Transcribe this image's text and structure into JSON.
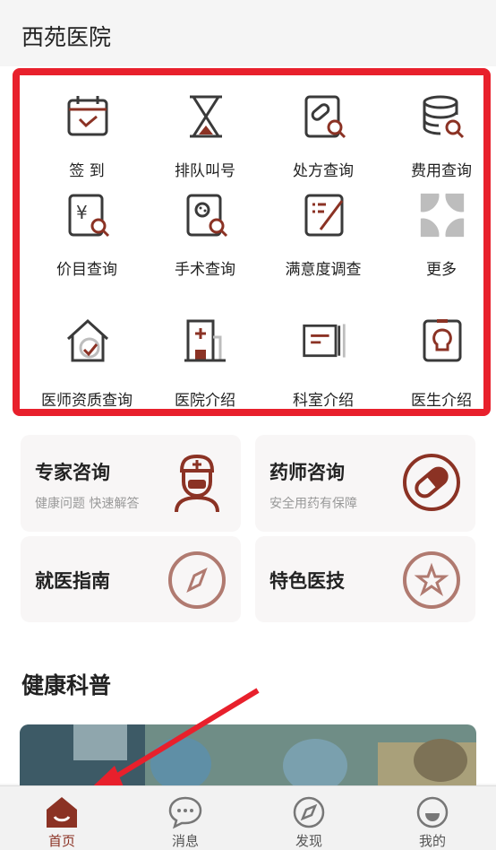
{
  "header": {
    "title": "西苑医院"
  },
  "grid": {
    "items": [
      {
        "label": "签 到",
        "icon": "checkin-calendar-icon"
      },
      {
        "label": "排队叫号",
        "icon": "hourglass-icon"
      },
      {
        "label": "处方查询",
        "icon": "prescription-search-icon"
      },
      {
        "label": "费用查询",
        "icon": "cost-search-icon"
      },
      {
        "label": "价目查询",
        "icon": "price-search-icon"
      },
      {
        "label": "手术查询",
        "icon": "surgery-search-icon"
      },
      {
        "label": "满意度调查",
        "icon": "survey-icon"
      },
      {
        "label": "更多",
        "icon": "more-icon"
      },
      {
        "label": "医师资质查询",
        "icon": "doctor-qualification-icon"
      },
      {
        "label": "医院介绍",
        "icon": "hospital-icon"
      },
      {
        "label": "科室介绍",
        "icon": "department-icon"
      },
      {
        "label": "医生介绍",
        "icon": "doctor-badge-icon"
      }
    ]
  },
  "cards": [
    {
      "title": "专家咨询",
      "subtitle": "健康问题 快速解答",
      "icon": "doctor-avatar-icon"
    },
    {
      "title": "药师咨询",
      "subtitle": "安全用药有保障",
      "icon": "pill-icon"
    },
    {
      "title": "就医指南",
      "subtitle": "",
      "icon": "compass-icon"
    },
    {
      "title": "特色医技",
      "subtitle": "",
      "icon": "star-icon"
    }
  ],
  "section": {
    "title": "健康科普"
  },
  "tabbar": {
    "tabs": [
      {
        "label": "首页",
        "icon": "home-icon",
        "active": true
      },
      {
        "label": "消息",
        "icon": "message-icon",
        "active": false
      },
      {
        "label": "发现",
        "icon": "discover-icon",
        "active": false
      },
      {
        "label": "我的",
        "icon": "profile-icon",
        "active": false
      }
    ]
  },
  "colors": {
    "accent": "#8b3224",
    "highlight_border": "#e8202c",
    "icon_dark": "#3a3a3a"
  }
}
